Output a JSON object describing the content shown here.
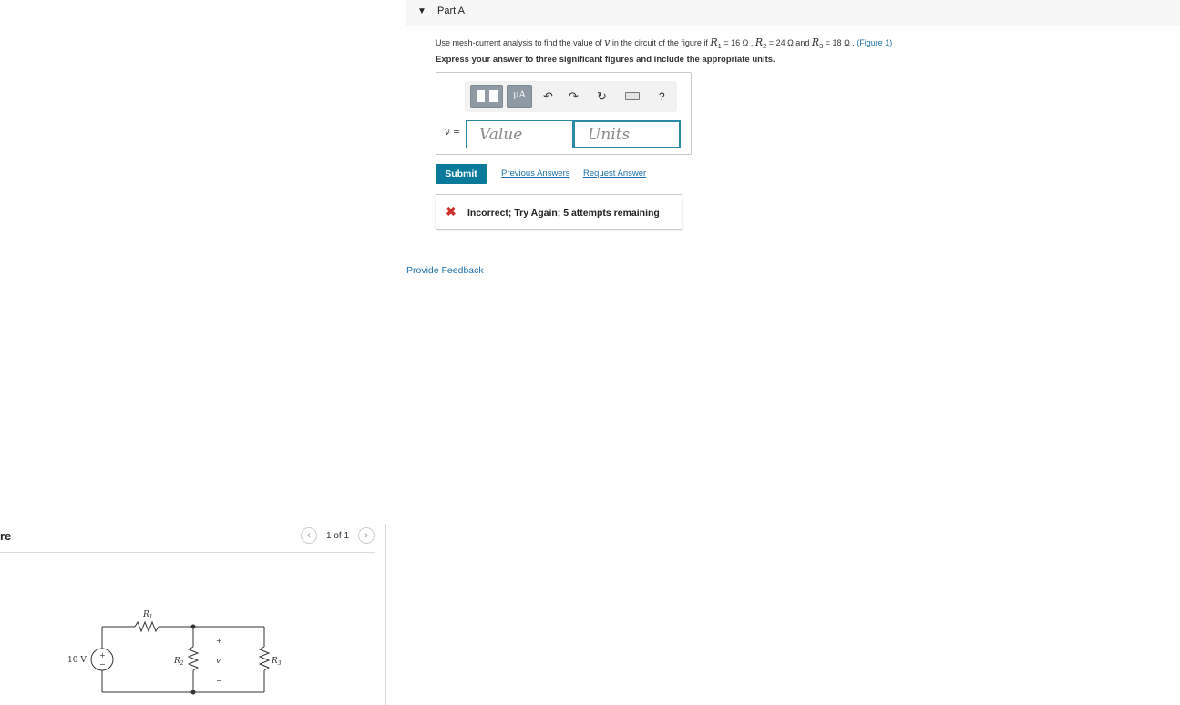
{
  "figure_panel": {
    "title": "re",
    "counter": "1 of 1",
    "prev_icon": "chevron-left-icon",
    "next_icon": "chevron-right-icon",
    "circuit": {
      "source_label": "10 V",
      "source_plus": "+",
      "source_minus": "−",
      "r1_label": "R",
      "r1_sub": "1",
      "r2_label": "R",
      "r2_sub": "2",
      "r3_label": "R",
      "r3_sub": "3",
      "v_label": "v",
      "v_plus": "+",
      "v_minus": "−"
    }
  },
  "part": {
    "title": "Part A",
    "caret": "▼"
  },
  "question": {
    "text_1": "Use mesh-current analysis to find the value of ",
    "var_v": "v",
    "text_2": " in the circuit of the figure if ",
    "r1": "R",
    "r1_sub": "1",
    "r1_val": " = 16 Ω , ",
    "r2": "R",
    "r2_sub": "2",
    "r2_val": " = 24 Ω and ",
    "r3": "R",
    "r3_sub": "3",
    "r3_val": " = 18 Ω . ",
    "figure_link": "(Figure 1)"
  },
  "instruction": "Express your answer to three significant figures and include the appropriate units.",
  "answer": {
    "toolbar": {
      "units_button": "μA",
      "undo_icon": "undo-icon",
      "redo_icon": "redo-icon",
      "reset_icon": "reset-icon",
      "keyboard_icon": "keyboard-icon",
      "help": "?"
    },
    "variable_label": "v",
    "equals": " =",
    "value_placeholder": "Value",
    "units_placeholder": "Units"
  },
  "actions": {
    "submit": "Submit",
    "previous_answers": "Previous Answers",
    "request_answer": "Request Answer"
  },
  "feedback": {
    "icon": "✖",
    "text": "Incorrect; Try Again; 5 attempts remaining",
    "color": "#d0302c"
  },
  "provide_feedback": "Provide Feedback",
  "colors": {
    "accent": "#0a7a9a",
    "link": "#1e6fa8",
    "input_border": "#2a8aa6"
  }
}
